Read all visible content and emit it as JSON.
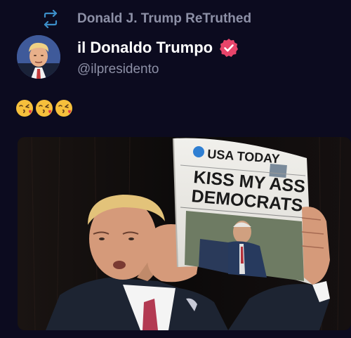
{
  "retruth": {
    "icon": "retruth-icon",
    "label": "Donald J. Trump ReTruthed"
  },
  "author": {
    "display_name": "il Donaldo Trumpo",
    "handle": "@ilpresidento",
    "verified_icon": "verified-badge-icon",
    "verified_color": "#e8446a"
  },
  "post": {
    "emojis": [
      "kissing-face-icon",
      "kissing-face-icon",
      "kissing-face-icon"
    ]
  },
  "media": {
    "newspaper_masthead": "USA TODAY",
    "newspaper_headline_line1": "KISS MY ASS",
    "newspaper_headline_line2": "DEMOCRATS"
  },
  "colors": {
    "background": "#0c0b1f",
    "muted_text": "#8d90a6",
    "accent_retruth": "#3c8ec8"
  }
}
